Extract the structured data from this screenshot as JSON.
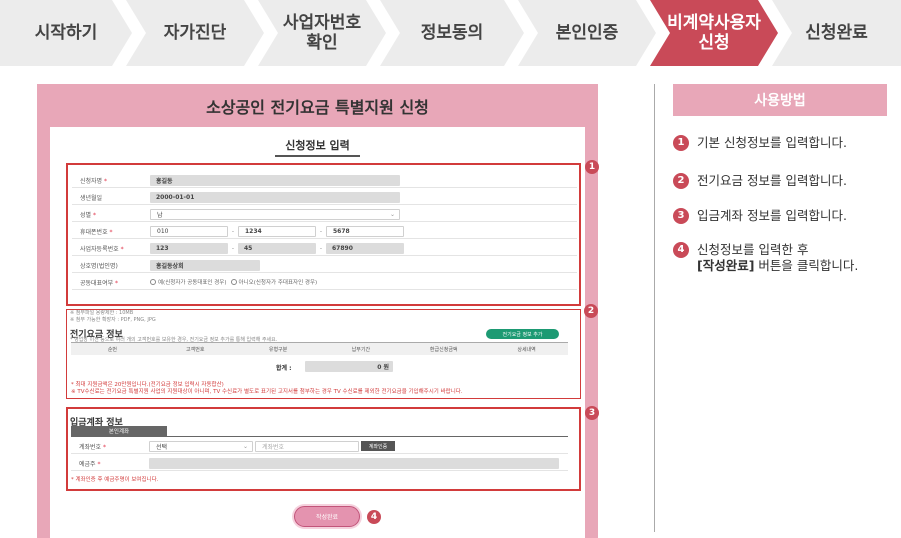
{
  "steps": [
    {
      "label": "시작하기",
      "active": false
    },
    {
      "label": "자가진단",
      "active": false
    },
    {
      "label": "사업자번호\n확인",
      "active": false
    },
    {
      "label": "정보동의",
      "active": false
    },
    {
      "label": "본인인증",
      "active": false
    },
    {
      "label": "비계약사용자\n신청",
      "active": true
    },
    {
      "label": "신청완료",
      "active": false
    }
  ],
  "form": {
    "title": "소상공인 전기요금 특별지원 신청",
    "tab": "신청정보 입력",
    "applicant": {
      "name_label": "신청자명",
      "name_value": "홍길동",
      "birth_label": "생년월일",
      "birth_value": "2000-01-01",
      "gender_label": "성별",
      "gender_value": "남",
      "phone_label": "휴대폰번호",
      "phone_1": "010",
      "phone_2": "1234",
      "phone_3": "5678",
      "bizno_label": "사업자등록번호",
      "bizno_1": "123",
      "bizno_2": "45",
      "bizno_3": "67890",
      "company_label": "상호명(법인명)",
      "company_value": "홍길동상회",
      "rep_label": "공동대표여부",
      "rep_option_1": "예(신청자가 공동대표인 경우)",
      "rep_option_2": "아니오(신청자가 주대표자인 경우)",
      "req_mark": "*",
      "note_1": "※ 첨부파일 용량제한 : 10MB",
      "note_2": "※ 첨부 가능한 확장자 : PDF, PNG, JPG"
    },
    "electric": {
      "title": "전기요금 정보",
      "subtitle": "* 영업장 이전 등으로 여러 개의 고객번호를 보유한 경우, 전기요금 정보 추가를 통해 입력해 주세요.",
      "add_button": "전기요금 정보 추가",
      "columns": [
        "순번",
        "고객번호",
        "유형구분",
        "납부기간",
        "환급신청금액",
        "상세내역"
      ],
      "total_label": "합계 :",
      "total_value": "0 원",
      "note_1": "* 최대 지원금액은 20만원입니다.(전기요금 정보 입력시 자동합산)",
      "note_2": "※ TV수신료는 전기요금 특별지원 사업의 지원대상이 아니며, TV 수신료가 별도로 표기된 고지서를 첨부하는 경우 TV 수신료를 제외한 전기요금을 기입해주시기 바랍니다."
    },
    "bank": {
      "title": "입금계좌 정보",
      "tab": "본인계좌",
      "account_label": "계좌번호",
      "bank_select": "선택",
      "account_placeholder": "계좌번호",
      "verify_button": "계좌인증",
      "holder_label": "예금주",
      "note": "* 계좌인증 후 예금주명이 보여집니다."
    },
    "submit": "작성완료",
    "badges": [
      "1",
      "2",
      "3",
      "4"
    ]
  },
  "guide": {
    "title": "사용방법",
    "items": [
      {
        "num": "1",
        "text": "기본 신청정보를 입력합니다."
      },
      {
        "num": "2",
        "text": "전기요금 정보를 입력합니다."
      },
      {
        "num": "3",
        "text": "입금계좌 정보를 입력합니다."
      },
      {
        "num": "4",
        "text_1": "신청정보를 입력한 후",
        "text_bold": "[작성완료]",
        "text_2": " 버튼을 클릭합니다."
      }
    ]
  },
  "colors": {
    "accent": "#c94a58",
    "panel": "#e8a7b8",
    "outline": "#d23b3b",
    "green": "#1d9a73"
  }
}
